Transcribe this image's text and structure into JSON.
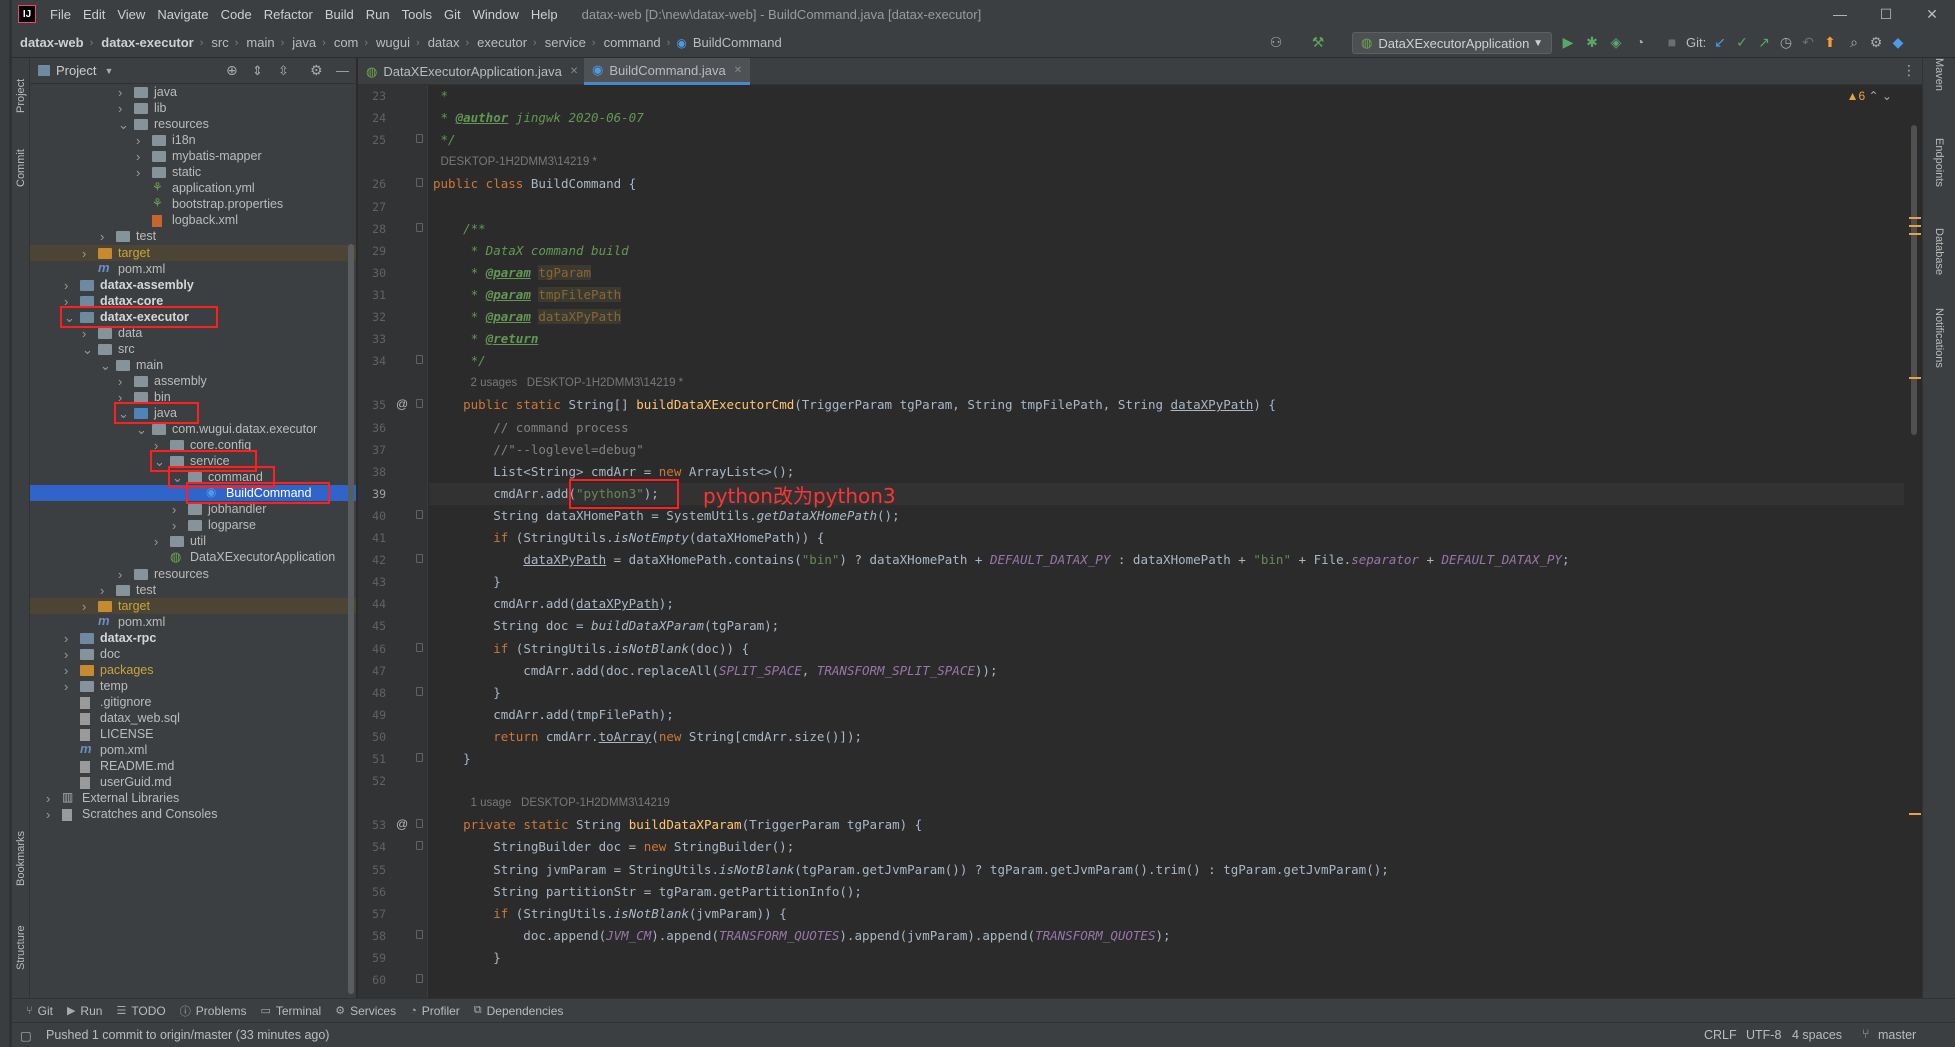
{
  "app": {
    "logo": "IJ",
    "menu": [
      "File",
      "Edit",
      "View",
      "Navigate",
      "Code",
      "Refactor",
      "Build",
      "Run",
      "Tools",
      "Git",
      "Window",
      "Help"
    ],
    "window_title": "datax-web [D:\\new\\datax-web] - BuildCommand.java [datax-executor]"
  },
  "breadcrumb": [
    "datax-web",
    "datax-executor",
    "src",
    "main",
    "java",
    "com",
    "wugui",
    "datax",
    "executor",
    "service",
    "command",
    "BuildCommand"
  ],
  "toolbar": {
    "run_config": "DataXExecutorApplication",
    "git_label": "Git:"
  },
  "left_tools": [
    "Project",
    "Commit",
    "Bookmarks",
    "Structure"
  ],
  "right_tools": [
    "Maven",
    "Endpoints",
    "Database",
    "Notifications"
  ],
  "project_panel": {
    "title": "Project"
  },
  "tree": [
    {
      "label": "java",
      "depth": 5,
      "kind": "folder",
      "arrow": "›"
    },
    {
      "label": "lib",
      "depth": 5,
      "kind": "folder",
      "arrow": "›"
    },
    {
      "label": "resources",
      "depth": 5,
      "kind": "folder",
      "arrow": "⌄"
    },
    {
      "label": "i18n",
      "depth": 6,
      "kind": "folder",
      "arrow": "›"
    },
    {
      "label": "mybatis-mapper",
      "depth": 6,
      "kind": "folder",
      "arrow": "›"
    },
    {
      "label": "static",
      "depth": 6,
      "kind": "folder",
      "arrow": "›"
    },
    {
      "label": "application.yml",
      "depth": 6,
      "kind": "yml",
      "arrow": ""
    },
    {
      "label": "bootstrap.properties",
      "depth": 6,
      "kind": "props",
      "arrow": ""
    },
    {
      "label": "logback.xml",
      "depth": 6,
      "kind": "xml",
      "arrow": ""
    },
    {
      "label": "test",
      "depth": 4,
      "kind": "folder",
      "arrow": "›"
    },
    {
      "label": "target",
      "depth": 3,
      "kind": "target",
      "arrow": "›"
    },
    {
      "label": "pom.xml",
      "depth": 3,
      "kind": "pom",
      "arrow": ""
    },
    {
      "label": "datax-assembly",
      "depth": 2,
      "kind": "module",
      "arrow": "›"
    },
    {
      "label": "datax-core",
      "depth": 2,
      "kind": "module",
      "arrow": "›"
    },
    {
      "label": "datax-executor",
      "depth": 2,
      "kind": "module",
      "arrow": "⌄"
    },
    {
      "label": "data",
      "depth": 3,
      "kind": "folder",
      "arrow": "›"
    },
    {
      "label": "src",
      "depth": 3,
      "kind": "folder",
      "arrow": "⌄"
    },
    {
      "label": "main",
      "depth": 4,
      "kind": "folder",
      "arrow": "⌄"
    },
    {
      "label": "assembly",
      "depth": 5,
      "kind": "folder",
      "arrow": "›"
    },
    {
      "label": "bin",
      "depth": 5,
      "kind": "folder",
      "arrow": "›"
    },
    {
      "label": "java",
      "depth": 5,
      "kind": "src",
      "arrow": "⌄"
    },
    {
      "label": "com.wugui.datax.executor",
      "depth": 6,
      "kind": "folder",
      "arrow": "⌄"
    },
    {
      "label": "core.config",
      "depth": 7,
      "kind": "folder",
      "arrow": "›"
    },
    {
      "label": "service",
      "depth": 7,
      "kind": "folder",
      "arrow": "⌄"
    },
    {
      "label": "command",
      "depth": 8,
      "kind": "folder",
      "arrow": "⌄"
    },
    {
      "label": "BuildCommand",
      "depth": 9,
      "kind": "class",
      "arrow": ""
    },
    {
      "label": "jobhandler",
      "depth": 8,
      "kind": "folder",
      "arrow": "›"
    },
    {
      "label": "logparse",
      "depth": 8,
      "kind": "folder",
      "arrow": "›"
    },
    {
      "label": "util",
      "depth": 7,
      "kind": "folder",
      "arrow": "›"
    },
    {
      "label": "DataXExecutorApplication",
      "depth": 7,
      "kind": "spring",
      "arrow": ""
    },
    {
      "label": "resources",
      "depth": 5,
      "kind": "folder",
      "arrow": "›"
    },
    {
      "label": "test",
      "depth": 4,
      "kind": "folder",
      "arrow": "›"
    },
    {
      "label": "target",
      "depth": 3,
      "kind": "target",
      "arrow": "›"
    },
    {
      "label": "pom.xml",
      "depth": 3,
      "kind": "pom",
      "arrow": ""
    },
    {
      "label": "datax-rpc",
      "depth": 2,
      "kind": "module",
      "arrow": "›"
    },
    {
      "label": "doc",
      "depth": 2,
      "kind": "folder",
      "arrow": "›"
    },
    {
      "label": "packages",
      "depth": 2,
      "kind": "orange",
      "arrow": "›"
    },
    {
      "label": "temp",
      "depth": 2,
      "kind": "folder",
      "arrow": "›"
    },
    {
      "label": ".gitignore",
      "depth": 2,
      "kind": "file",
      "arrow": ""
    },
    {
      "label": "datax_web.sql",
      "depth": 2,
      "kind": "file",
      "arrow": ""
    },
    {
      "label": "LICENSE",
      "depth": 2,
      "kind": "file",
      "arrow": ""
    },
    {
      "label": "pom.xml",
      "depth": 2,
      "kind": "pom",
      "arrow": ""
    },
    {
      "label": "README.md",
      "depth": 2,
      "kind": "file",
      "arrow": ""
    },
    {
      "label": "userGuid.md",
      "depth": 2,
      "kind": "file",
      "arrow": ""
    },
    {
      "label": "External Libraries",
      "depth": 1,
      "kind": "lib",
      "arrow": "›"
    },
    {
      "label": "Scratches and Consoles",
      "depth": 1,
      "kind": "file",
      "arrow": "›"
    }
  ],
  "editor": {
    "tabs": [
      {
        "label": "DataXExecutorApplication.java",
        "active": false
      },
      {
        "label": "BuildCommand.java",
        "active": true
      }
    ],
    "warnings": "▲6",
    "annotation": "python改为python3",
    "lines": [
      {
        "n": "23",
        "html": "<span class='doc'> *</span>"
      },
      {
        "n": "24",
        "html": "<span class='doc'> * </span><span class='tag'>@author</span><span class='doc'> jingwk 2020-06-07</span>"
      },
      {
        "n": "25",
        "html": "<span class='doc'> */</span>"
      },
      {
        "n": "",
        "hint": "DESKTOP-1H2DMM3\\14219 *"
      },
      {
        "n": "26",
        "html": "<span class='kw'>public class </span>BuildCommand {"
      },
      {
        "n": "27",
        "html": ""
      },
      {
        "n": "28",
        "html": "    <span class='doc'>/**</span>"
      },
      {
        "n": "29",
        "html": "<span class='doc'>     * DataX command build</span>"
      },
      {
        "n": "30",
        "html": "<span class='doc'>     * </span><span class='tag'>@param</span><span class='doc'> </span><span class='prm'>tgParam</span>"
      },
      {
        "n": "31",
        "html": "<span class='doc'>     * </span><span class='tag'>@param</span><span class='doc'> </span><span class='prm'>tmpFilePath</span>"
      },
      {
        "n": "32",
        "html": "<span class='doc'>     * </span><span class='tag'>@param</span><span class='doc'> </span><span class='prm'>dataXPyPath</span>"
      },
      {
        "n": "33",
        "html": "<span class='doc'>     * </span><span class='tag'>@return</span>"
      },
      {
        "n": "34",
        "html": "<span class='doc'>     */</span>"
      },
      {
        "n": "",
        "hint": "2 usages   DESKTOP-1H2DMM3\\14219 *"
      },
      {
        "n": "35",
        "html": "    <span class='kw'>public static </span>String[] <span class='fn'>buildDataXExecutorCmd</span>(TriggerParam tgParam, String tmpFilePath, String <span class='ul'>dataXPyPath</span>) {"
      },
      {
        "n": "36",
        "html": "        <span class='cm'>// command process</span>"
      },
      {
        "n": "37",
        "html": "        <span class='cm'>//\"--loglevel=debug\"</span>"
      },
      {
        "n": "38",
        "html": "        List&lt;String&gt; cmdArr = <span class='kw'>new </span>ArrayList&lt;&gt;();"
      },
      {
        "n": "39",
        "html": "        cmdArr.add(<span class='str'>\"python3\"</span>);",
        "caret": true
      },
      {
        "n": "40",
        "html": "        String dataXHomePath = SystemUtils.<span class='it'>getDataXHomePath</span>();"
      },
      {
        "n": "41",
        "html": "        <span class='kw'>if </span>(StringUtils.<span class='it'>isNotEmpty</span>(dataXHomePath)) {"
      },
      {
        "n": "42",
        "html": "            <span class='ul'>dataXPyPath</span> = dataXHomePath.contains(<span class='str'>\"bin\"</span>) ? dataXHomePath + <span class='st'>DEFAULT_DATAX_PY</span> : dataXHomePath + <span class='str'>\"bin\"</span> + File.<span class='st'>separator</span> + <span class='st'>DEFAULT_DATAX_PY</span>;"
      },
      {
        "n": "43",
        "html": "        }"
      },
      {
        "n": "44",
        "html": "        cmdArr.add(<span class='ul'>dataXPyPath</span>);"
      },
      {
        "n": "45",
        "html": "        String doc = <span class='it'>buildDataXParam</span>(tgParam);"
      },
      {
        "n": "46",
        "html": "        <span class='kw'>if </span>(StringUtils.<span class='it'>isNotBlank</span>(doc)) {"
      },
      {
        "n": "47",
        "html": "            cmdArr.add(doc.replaceAll(<span class='st'>SPLIT_SPACE</span>, <span class='st'>TRANSFORM_SPLIT_SPACE</span>));"
      },
      {
        "n": "48",
        "html": "        }"
      },
      {
        "n": "49",
        "html": "        cmdArr.add(tmpFilePath);"
      },
      {
        "n": "50",
        "html": "        <span class='kw'>return </span>cmdArr.<span class='ul'>toArray</span>(<span class='kw'>new </span>String[cmdArr.size()]);"
      },
      {
        "n": "51",
        "html": "    }"
      },
      {
        "n": "52",
        "html": ""
      },
      {
        "n": "",
        "hint": "1 usage   DESKTOP-1H2DMM3\\14219"
      },
      {
        "n": "53",
        "html": "    <span class='kw'>private static </span>String <span class='fn'>buildDataXParam</span>(TriggerParam tgParam) {"
      },
      {
        "n": "54",
        "html": "        StringBuilder doc = <span class='kw'>new </span>StringBuilder();"
      },
      {
        "n": "55",
        "html": "        String jvmParam = StringUtils.<span class='it'>isNotBlank</span>(tgParam.getJvmParam()) ? tgParam.getJvmParam().trim() : tgParam.getJvmParam();"
      },
      {
        "n": "56",
        "html": "        String partitionStr = tgParam.getPartitionInfo();"
      },
      {
        "n": "57",
        "html": "        <span class='kw'>if </span>(StringUtils.<span class='it'>isNotBlank</span>(jvmParam)) {"
      },
      {
        "n": "58",
        "html": "            doc.append(<span class='st'>JVM_CM</span>).append(<span class='st'>TRANSFORM_QUOTES</span>).append(jvmParam).append(<span class='st'>TRANSFORM_QUOTES</span>);"
      },
      {
        "n": "59",
        "html": "        }"
      },
      {
        "n": "60",
        "html": ""
      }
    ]
  },
  "bottom_tools": [
    "Git",
    "Run",
    "TODO",
    "Problems",
    "Terminal",
    "Services",
    "Profiler",
    "Dependencies"
  ],
  "status": {
    "message": "Pushed 1 commit to origin/master (33 minutes ago)",
    "line_sep": "CRLF",
    "encoding": "UTF-8",
    "indent": "4 spaces",
    "branch": "master"
  }
}
